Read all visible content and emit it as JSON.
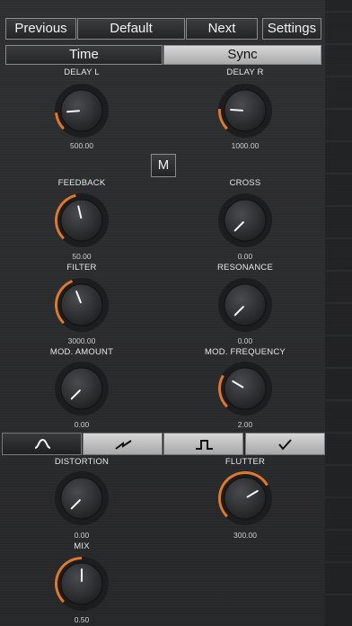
{
  "toolbar": {
    "previous_label": "Previous",
    "preset_name": "Default",
    "next_label": "Next",
    "settings_label": "Settings"
  },
  "mode_tabs": [
    {
      "label": "Time",
      "selected": false
    },
    {
      "label": "Sync",
      "selected": true
    }
  ],
  "modulation_button_label": "M",
  "accent_color": "#e0782a",
  "knobs": {
    "delay_l": {
      "label": "DELAY L",
      "value": "500.00",
      "level": 0.15
    },
    "delay_r": {
      "label": "DELAY R",
      "value": "1000.00",
      "level": 0.18
    },
    "feedback": {
      "label": "FEEDBACK",
      "value": "50.00",
      "level": 0.45
    },
    "cross": {
      "label": "CROSS",
      "value": "0.00",
      "level": 0.0
    },
    "filter": {
      "label": "FILTER",
      "value": "3000.00",
      "level": 0.42
    },
    "resonance": {
      "label": "RESONANCE",
      "value": "0.00",
      "level": 0.0
    },
    "mod_amount": {
      "label": "MOD. AMOUNT",
      "value": "0.00",
      "level": 0.0
    },
    "mod_frequency": {
      "label": "MOD. FREQUENCY",
      "value": "2.00",
      "level": 0.28
    },
    "distortion": {
      "label": "DISTORTION",
      "value": "0.00",
      "level": 0.0
    },
    "flutter": {
      "label": "FLUTTER",
      "value": "300.00",
      "level": 0.72
    },
    "mix": {
      "label": "MIX",
      "value": "0.50",
      "level": 0.5
    }
  },
  "waveforms": [
    {
      "icon": "sine-wave-icon",
      "selected": true
    },
    {
      "icon": "sawtooth-wave-icon",
      "selected": false
    },
    {
      "icon": "square-wave-icon",
      "selected": false
    },
    {
      "icon": "triangle-wave-icon",
      "selected": false
    }
  ]
}
